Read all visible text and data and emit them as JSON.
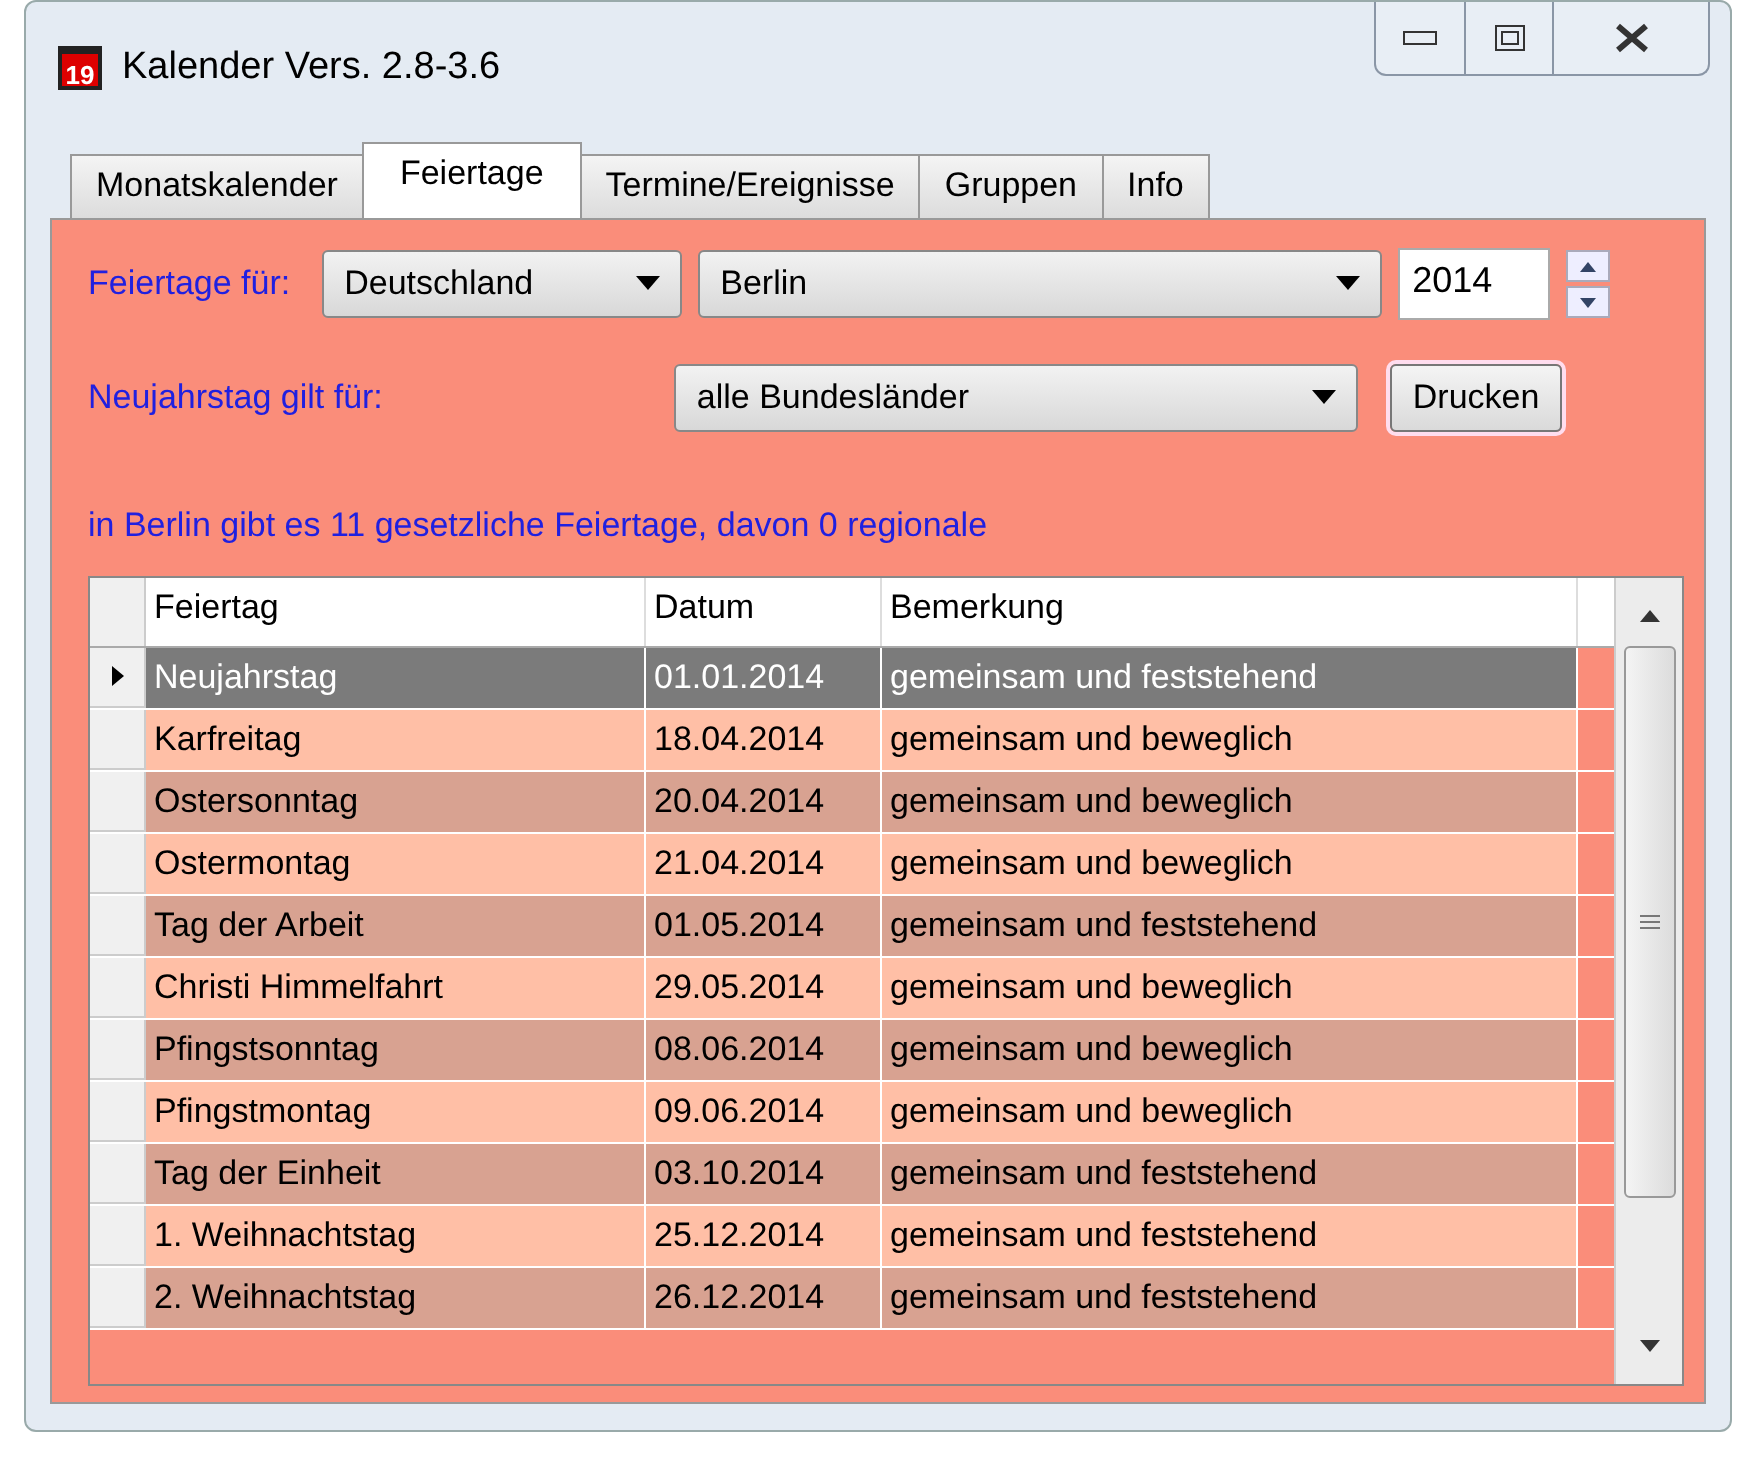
{
  "window": {
    "title": "Kalender Vers. 2.8-3.6",
    "icon_text": "19"
  },
  "tabs": [
    {
      "label": "Monatskalender",
      "selected": false
    },
    {
      "label": "Feiertage",
      "selected": true
    },
    {
      "label": "Termine/Ereignisse",
      "selected": false
    },
    {
      "label": "Gruppen",
      "selected": false
    },
    {
      "label": "Info",
      "selected": false
    }
  ],
  "filters": {
    "label": "Feiertage für:",
    "country": "Deutschland",
    "state": "Berlin",
    "year": "2014"
  },
  "newyear": {
    "label": "Neujahrstag gilt für:",
    "value": "alle Bundesländer",
    "button": "Drucken"
  },
  "summary": "in Berlin gibt es 11 gesetzliche Feiertage, davon 0 regionale",
  "table": {
    "columns": [
      "Feiertag",
      "Datum",
      "Bemerkung"
    ],
    "rows": [
      {
        "cells": [
          "Neujahrstag",
          "01.01.2014",
          "gemeinsam und feststehend"
        ],
        "selected": true
      },
      {
        "cells": [
          "Karfreitag",
          "18.04.2014",
          "gemeinsam und beweglich"
        ],
        "selected": false
      },
      {
        "cells": [
          "Ostersonntag",
          "20.04.2014",
          "gemeinsam und beweglich"
        ],
        "selected": false
      },
      {
        "cells": [
          "Ostermontag",
          "21.04.2014",
          "gemeinsam und beweglich"
        ],
        "selected": false
      },
      {
        "cells": [
          "Tag der Arbeit",
          "01.05.2014",
          "gemeinsam und feststehend"
        ],
        "selected": false
      },
      {
        "cells": [
          "Christi Himmelfahrt",
          "29.05.2014",
          "gemeinsam und beweglich"
        ],
        "selected": false
      },
      {
        "cells": [
          "Pfingstsonntag",
          "08.06.2014",
          "gemeinsam und beweglich"
        ],
        "selected": false
      },
      {
        "cells": [
          "Pfingstmontag",
          "09.06.2014",
          "gemeinsam und beweglich"
        ],
        "selected": false
      },
      {
        "cells": [
          "Tag der Einheit",
          "03.10.2014",
          "gemeinsam und feststehend"
        ],
        "selected": false
      },
      {
        "cells": [
          "1. Weihnachtstag",
          "25.12.2014",
          "gemeinsam und feststehend"
        ],
        "selected": false
      },
      {
        "cells": [
          "2. Weihnachtstag",
          "26.12.2014",
          "gemeinsam und feststehend"
        ],
        "selected": false
      }
    ]
  }
}
